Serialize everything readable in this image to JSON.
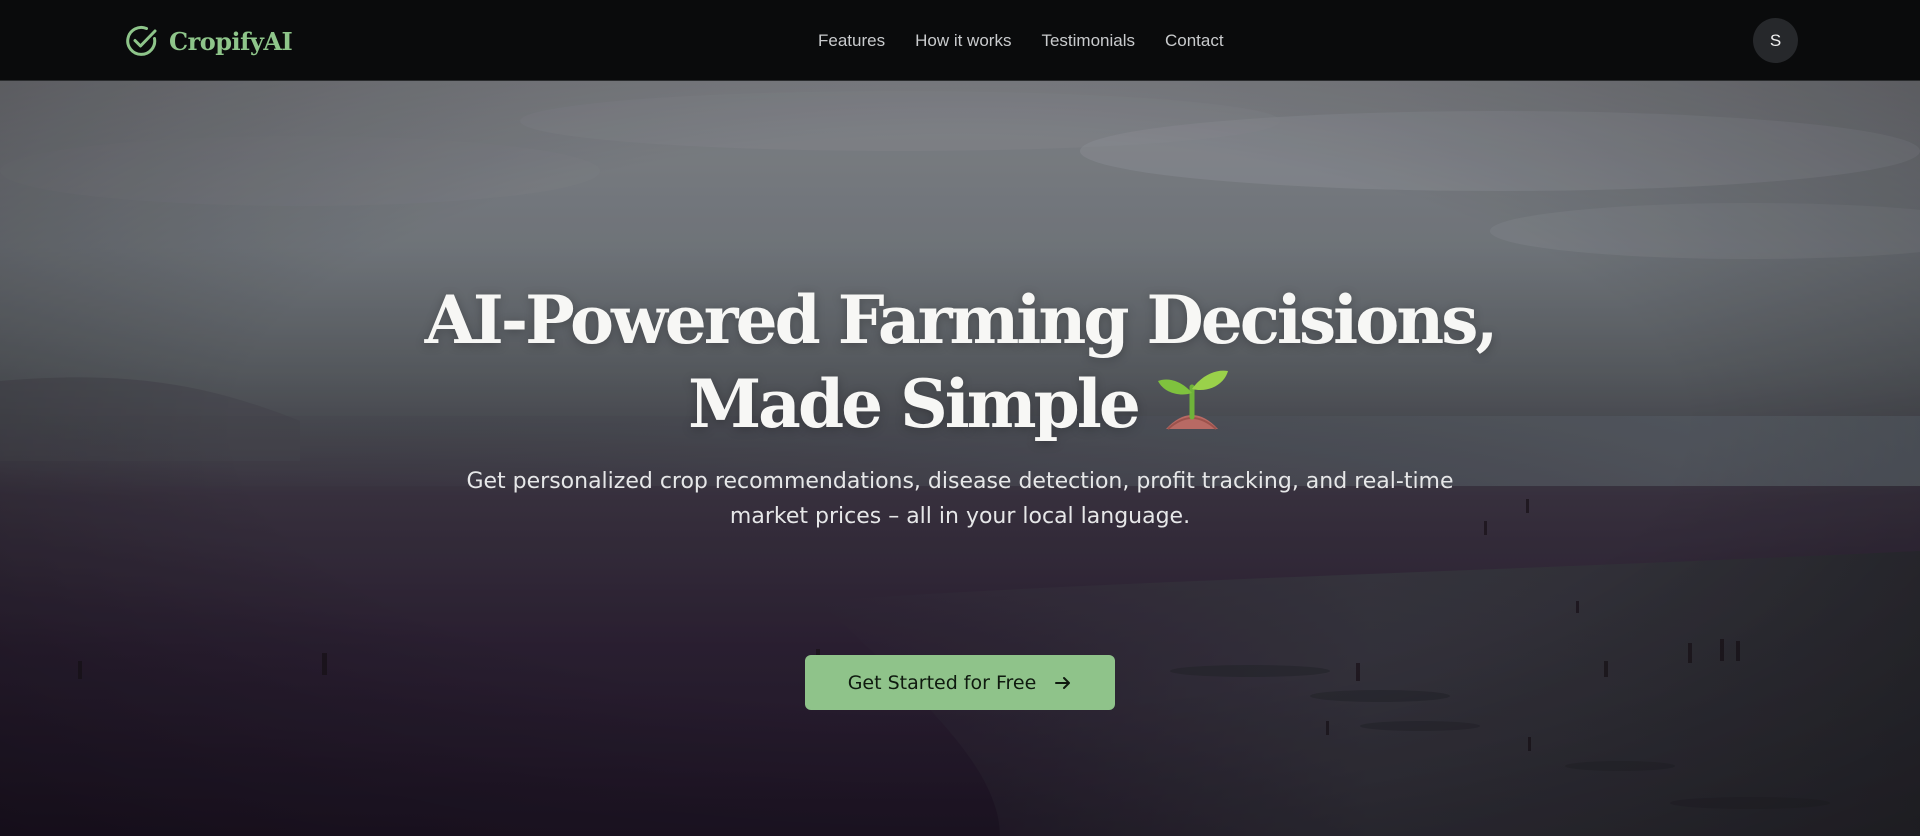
{
  "brand": {
    "name": "CropifyAI",
    "icon": "check-circle-icon",
    "color": "#8ec58a"
  },
  "nav": {
    "items": [
      {
        "label": "Features"
      },
      {
        "label": "How it works"
      },
      {
        "label": "Testimonials"
      },
      {
        "label": "Contact"
      }
    ]
  },
  "user": {
    "avatar_initial": "S"
  },
  "hero": {
    "headline_line1": "AI-Powered Farming Decisions,",
    "headline_line2": "Made Simple",
    "headline_emoji_icon": "seedling-icon",
    "subtitle": "Get personalized crop recommendations, disease detection, profit tracking, and real-time market prices – all in your local language.",
    "cta_label": "Get Started for Free",
    "cta_icon": "arrow-right-icon",
    "cta_color": "#8fc38a"
  }
}
